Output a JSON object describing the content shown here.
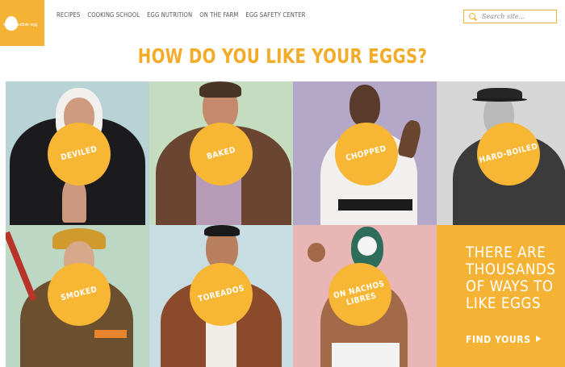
{
  "brand": {
    "logo_text": "the incredible egg",
    "accent": "#f5b335"
  },
  "nav": {
    "items": [
      {
        "label": "RECIPES"
      },
      {
        "label": "COOKING SCHOOL"
      },
      {
        "label": "EGG NUTRITION"
      },
      {
        "label": "ON THE FARM"
      },
      {
        "label": "EGG SAFETY CENTER"
      }
    ]
  },
  "search": {
    "placeholder": "Search site...",
    "icon": "search-icon"
  },
  "page": {
    "title": "HOW DO YOU LIKE YOUR EGGS?"
  },
  "tiles": [
    {
      "label": "DEVILED",
      "bg": "#b8d2d6"
    },
    {
      "label": "BAKED",
      "bg": "#c4dcc0"
    },
    {
      "label": "CHOPPED",
      "bg": "#b4a8c8"
    },
    {
      "label": "HARD-BOILED",
      "bg": "#d6d6d6"
    },
    {
      "label": "SMOKED",
      "bg": "#bcd8c4"
    },
    {
      "label": "TOREADOS",
      "bg": "#c8dde2"
    },
    {
      "label": "ON NACHOS\nLIBRES",
      "bg": "#e8b6b4"
    }
  ],
  "cta": {
    "text": "THERE ARE THOUSANDS OF WAYS TO LIKE EGGS",
    "link": "FIND YOURS"
  }
}
